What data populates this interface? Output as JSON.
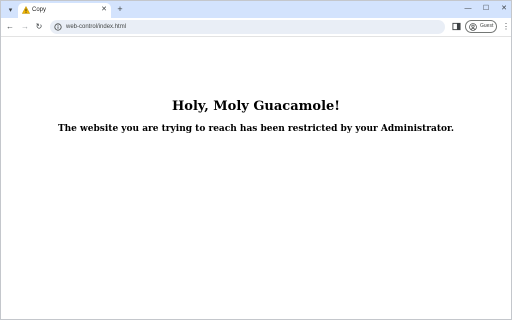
{
  "browser": {
    "tab": {
      "title": "Copy",
      "status_icon": "warning-icon"
    },
    "address_bar": {
      "url": "web-control/index.html",
      "site_icon": "site-info-icon"
    },
    "profile": {
      "label": "Guest"
    },
    "colors": {
      "tab_strip": "#d3e3fd",
      "omnibox": "#e9eef6",
      "warning": "#f2b600"
    }
  },
  "page": {
    "heading": "Holy, Moly Guacamole!",
    "message": "The website you are trying to reach has been restricted by your Administrator."
  }
}
